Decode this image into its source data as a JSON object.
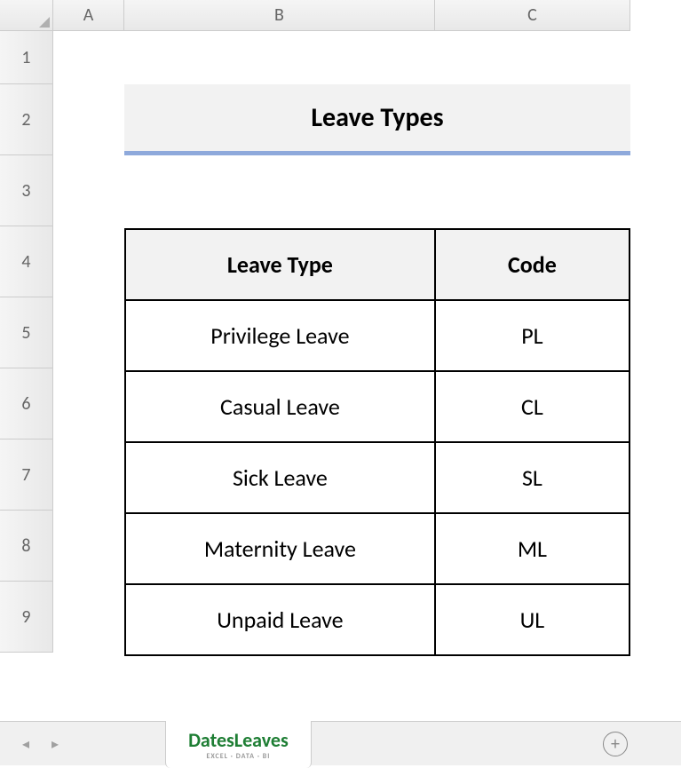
{
  "columns": {
    "a": "A",
    "b": "B",
    "c": "C"
  },
  "rows": [
    "1",
    "2",
    "3",
    "4",
    "5",
    "6",
    "7",
    "8",
    "9"
  ],
  "title": "Leave Types",
  "table": {
    "headers": {
      "type": "Leave Type",
      "code": "Code"
    },
    "data": [
      {
        "type": "Privilege Leave",
        "code": "PL"
      },
      {
        "type": "Casual Leave",
        "code": "CL"
      },
      {
        "type": "Sick Leave",
        "code": "SL"
      },
      {
        "type": "Maternity Leave",
        "code": "ML"
      },
      {
        "type": "Unpaid Leave",
        "code": "UL"
      }
    ]
  },
  "tabs": {
    "active": "DatesLeaves",
    "sub": "EXCEL · DATA · BI"
  },
  "icons": {
    "prev": "◂",
    "next": "▸",
    "add": "+"
  }
}
